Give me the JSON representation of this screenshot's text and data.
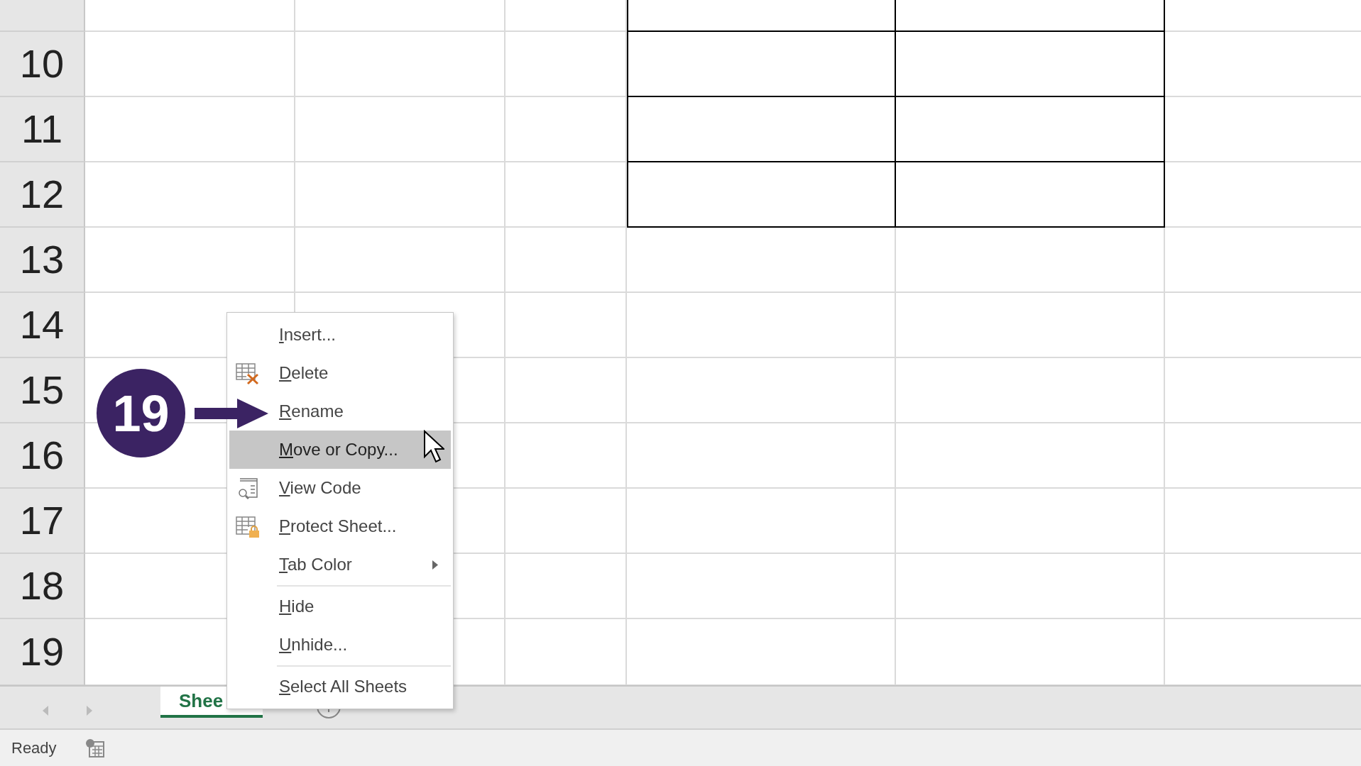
{
  "grid": {
    "columns": [
      {
        "bordered": false
      },
      {
        "bordered": false
      },
      {
        "bordered": false
      },
      {
        "bordered": true
      },
      {
        "bordered": true
      },
      {
        "bordered": false
      }
    ],
    "rows": [
      {
        "bordered": true
      },
      {
        "header": "10",
        "bordered": true
      },
      {
        "header": "11",
        "bordered": true
      },
      {
        "header": "12",
        "bordered": true
      },
      {
        "header": "13",
        "bordered": false
      },
      {
        "header": "14",
        "bordered": false
      },
      {
        "header": "15",
        "bordered": false
      },
      {
        "header": "16",
        "bordered": false
      },
      {
        "header": "17",
        "bordered": false
      },
      {
        "header": "18",
        "bordered": false
      },
      {
        "header": "19",
        "bordered": false
      }
    ]
  },
  "context_menu": {
    "items": [
      {
        "kind": "item",
        "label": "Insert...",
        "selected": false,
        "submenu": false
      },
      {
        "kind": "item",
        "label": "Delete",
        "selected": false,
        "submenu": false
      },
      {
        "kind": "item",
        "label": "Rename",
        "selected": false,
        "submenu": false
      },
      {
        "kind": "item",
        "label": "Move or Copy...",
        "selected": true,
        "submenu": false
      },
      {
        "kind": "item",
        "label": "View Code",
        "selected": false,
        "submenu": false
      },
      {
        "kind": "item",
        "label": "Protect Sheet...",
        "selected": false,
        "submenu": false
      },
      {
        "kind": "item",
        "label": "Tab Color",
        "selected": false,
        "submenu": true
      },
      {
        "kind": "separator"
      },
      {
        "kind": "item",
        "label": "Hide",
        "selected": false,
        "submenu": false
      },
      {
        "kind": "item",
        "label": "Unhide...",
        "selected": false,
        "submenu": false
      },
      {
        "kind": "separator"
      },
      {
        "kind": "item",
        "label": "Select All Sheets",
        "selected": false,
        "submenu": false
      }
    ]
  },
  "annotation": {
    "step": "19"
  },
  "sheet_tabs": [
    {
      "label": "Shee",
      "selected": true
    }
  ],
  "status_bar": {
    "text": "Ready"
  }
}
